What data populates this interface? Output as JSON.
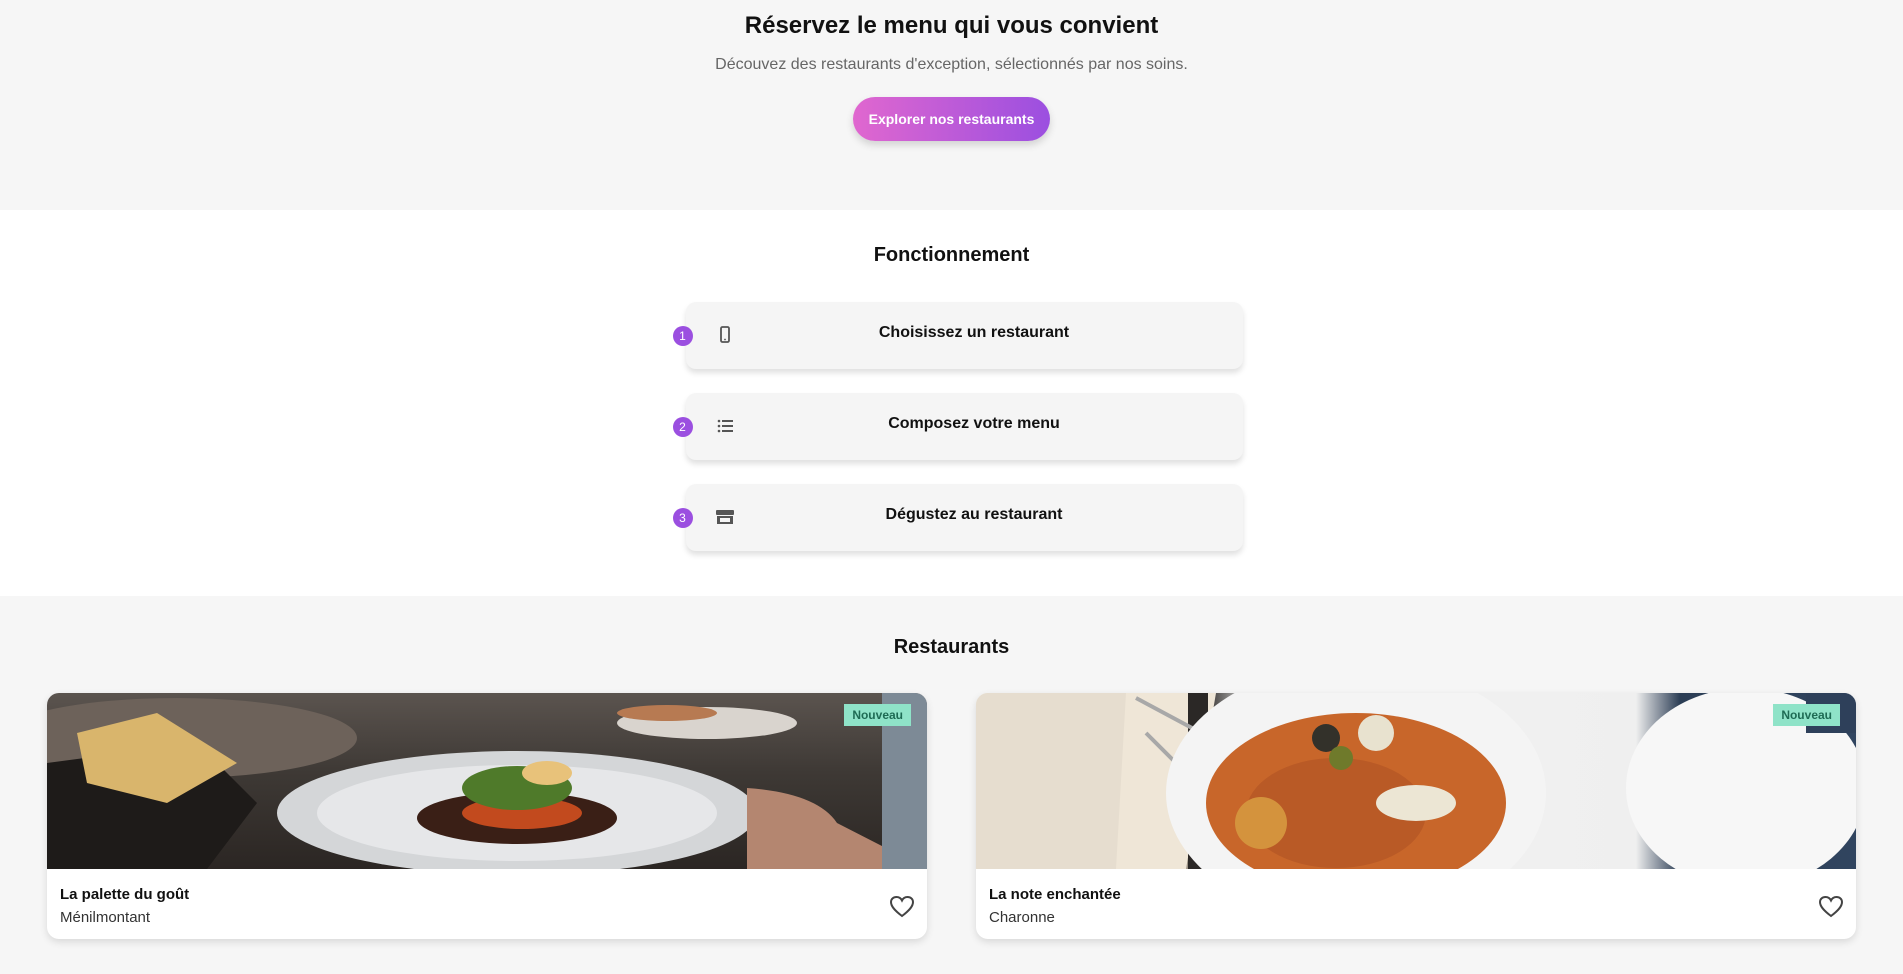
{
  "hero": {
    "title": "Réservez le menu qui vous convient",
    "subtitle": "Découvez des restaurants d'exception, sélectionnés par nos soins.",
    "cta_label": "Explorer nos restaurants"
  },
  "how": {
    "title": "Fonctionnement",
    "steps": [
      {
        "num": "1",
        "label": "Choisissez un restaurant",
        "icon": "phone-icon"
      },
      {
        "num": "2",
        "label": "Composez votre menu",
        "icon": "list-icon"
      },
      {
        "num": "3",
        "label": "Dégustez au restaurant",
        "icon": "store-icon"
      }
    ]
  },
  "restaurants": {
    "title": "Restaurants",
    "cards": [
      {
        "name": "La palette du goût",
        "area": "Ménilmontant",
        "badge": "Nouveau"
      },
      {
        "name": "La note enchantée",
        "area": "Charonne",
        "badge": "Nouveau"
      }
    ]
  },
  "colors": {
    "accent": "#9b4fe0",
    "cta_gradient_start": "#e067cf",
    "badge_bg": "#8fe3c8"
  }
}
